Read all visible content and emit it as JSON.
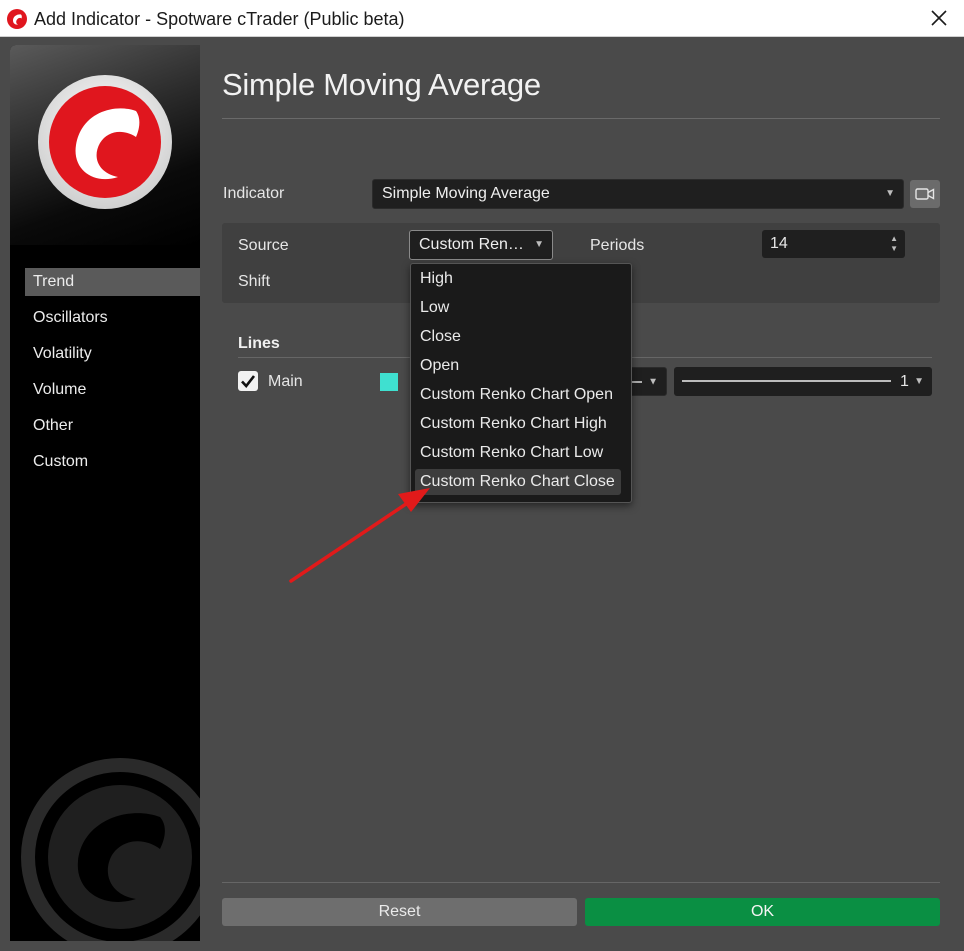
{
  "window": {
    "title": "Add Indicator - Spotware cTrader (Public beta)"
  },
  "sidebar": {
    "categories": [
      {
        "label": "Trend",
        "active": true
      },
      {
        "label": "Oscillators",
        "active": false
      },
      {
        "label": "Volatility",
        "active": false
      },
      {
        "label": "Volume",
        "active": false
      },
      {
        "label": "Other",
        "active": false
      },
      {
        "label": "Custom",
        "active": false
      }
    ]
  },
  "main": {
    "title": "Simple Moving Average",
    "indicator": {
      "label": "Indicator",
      "value": "Simple Moving Average"
    },
    "parameters": {
      "source_label": "Source",
      "source_value": "Custom Ren…",
      "periods_label": "Periods",
      "periods_value": "14",
      "shift_label": "Shift"
    },
    "lines": {
      "heading": "Lines",
      "items": [
        {
          "label": "Main",
          "checked": true,
          "color": "#3fe0d0",
          "thickness": "1"
        }
      ]
    },
    "buttons": {
      "reset": "Reset",
      "ok": "OK"
    }
  },
  "source_dropdown": {
    "options": [
      "High",
      "Low",
      "Close",
      "Open",
      "Custom Renko Chart Open",
      "Custom Renko Chart High",
      "Custom Renko Chart Low",
      "Custom Renko Chart Close"
    ],
    "highlighted": "Custom Renko Chart Close"
  },
  "colors": {
    "accent_ok": "#0a8f43",
    "brand_red": "#e0161e",
    "line_color": "#3fe0d0",
    "annotation_arrow": "#e11a1a"
  }
}
